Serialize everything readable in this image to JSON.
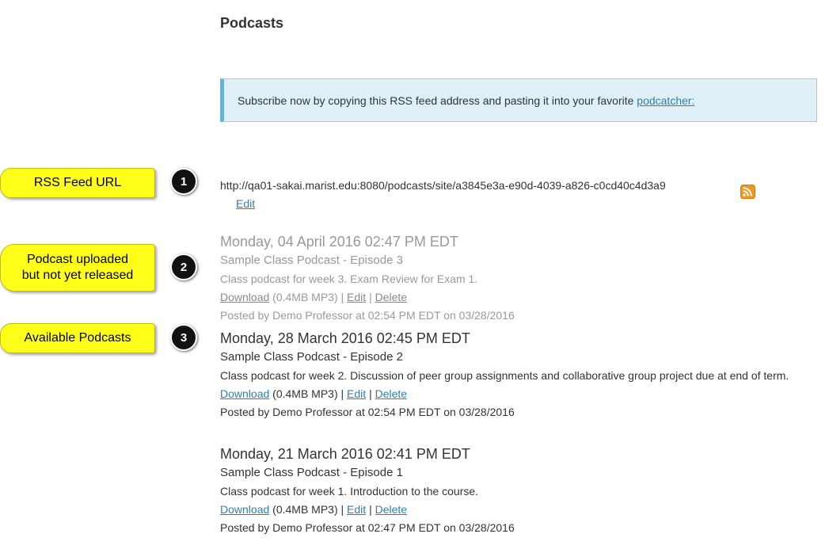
{
  "page": {
    "title": "Podcasts"
  },
  "info": {
    "text": "Subscribe now by copying this RSS feed address and pasting it into your favorite ",
    "link_label": "podcatcher:"
  },
  "feed": {
    "url": "http://qa01-sakai.marist.edu:8080/podcasts/site/a3845e3a-e90d-4039-a826-c0cd40c4d3a9",
    "edit_label": "Edit",
    "icon": "rss-icon",
    "icon_color": "#f7941d"
  },
  "callouts": [
    {
      "label": "RSS Feed URL",
      "number": "1"
    },
    {
      "label_line1": "Podcast uploaded",
      "label_line2": "but not yet released",
      "number": "2"
    },
    {
      "label": "Available Podcasts",
      "number": "3"
    }
  ],
  "podcasts": [
    {
      "date": "Monday, 04 April 2016 02:47 PM EDT",
      "title": "Sample Class Podcast - Episode 3",
      "description": "Class podcast for week 3. Exam Review for Exam 1.",
      "download_label": "Download",
      "size": "(0.4MB MP3)",
      "sep1": "|",
      "edit_label": "Edit",
      "sep2": "|",
      "delete_label": "Delete",
      "posted": "Posted by Demo Professor at 02:54 PM EDT on 03/28/2016",
      "released": false
    },
    {
      "date": "Monday, 28 March 2016 02:45 PM EDT",
      "title": "Sample Class Podcast - Episode 2",
      "description": "Class podcast for week 2. Discussion of peer group assignments and collaborative group project due at end of term.",
      "download_label": "Download",
      "size": "(0.4MB MP3)",
      "sep1": "|",
      "edit_label": "Edit",
      "sep2": "|",
      "delete_label": "Delete",
      "posted": "Posted by Demo Professor at 02:54 PM EDT on 03/28/2016",
      "released": true
    },
    {
      "date": "Monday, 21 March 2016 02:41 PM EDT",
      "title": "Sample Class Podcast - Episode 1",
      "description": "Class podcast for week 1. Introduction to the course.",
      "download_label": "Download",
      "size": "(0.4MB MP3)",
      "sep1": "|",
      "edit_label": "Edit",
      "sep2": "|",
      "delete_label": "Delete",
      "posted": "Posted by Demo Professor at 02:47 PM EDT on 03/28/2016",
      "released": true
    }
  ]
}
